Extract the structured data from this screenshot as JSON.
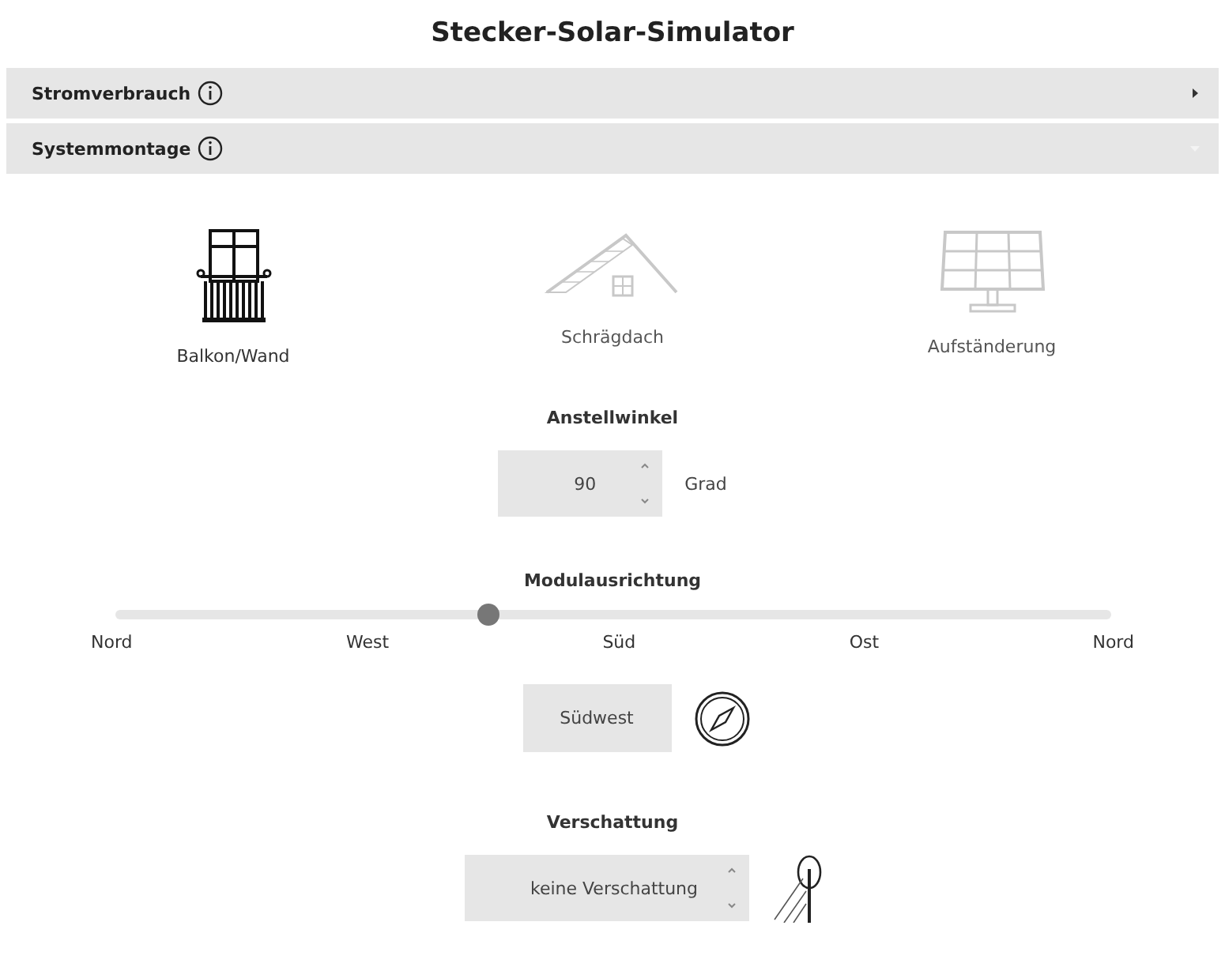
{
  "title": "Stecker-Solar-Simulator",
  "sections": [
    {
      "label": "Stromverbrauch",
      "expanded": false
    },
    {
      "label": "Systemmontage",
      "expanded": true
    }
  ],
  "mounting_options": [
    {
      "kind": "balcony",
      "label": "Balkon/Wand",
      "selected": true
    },
    {
      "kind": "roof",
      "label": "Schrägdach",
      "selected": false
    },
    {
      "kind": "stand",
      "label": "Aufständerung",
      "selected": false
    }
  ],
  "angle": {
    "label": "Anstellwinkel",
    "value": "90",
    "unit": "Grad"
  },
  "orientation": {
    "label": "Modulausrichtung",
    "level": 0.375,
    "ticks": [
      "Nord",
      "West",
      "Süd",
      "Ost",
      "Nord"
    ],
    "value": "Südwest"
  },
  "shading": {
    "label": "Verschattung",
    "value": "keine Verschattung"
  }
}
